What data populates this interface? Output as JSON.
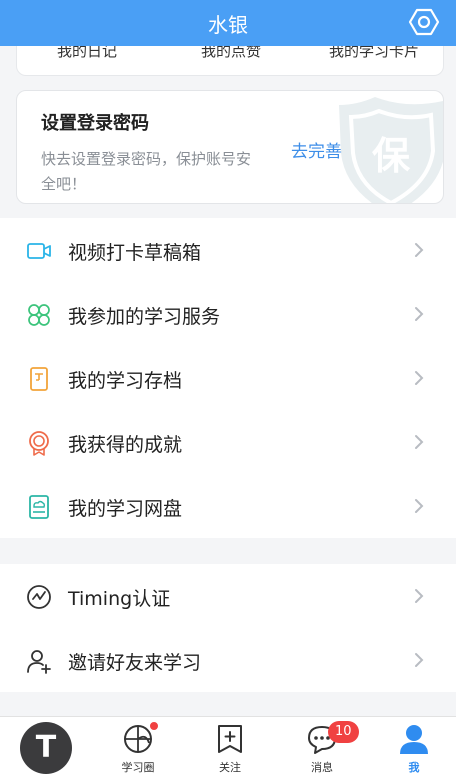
{
  "header": {
    "title": "水银",
    "settings_icon": "gear-icon"
  },
  "stats": [
    "我的日记",
    "我的点赞",
    "我的学习卡片"
  ],
  "password_card": {
    "title": "设置登录密码",
    "description": "快去设置登录密码，保护账号安全吧！",
    "action": "去完善",
    "shield_glyph": "保"
  },
  "menu_group_1": [
    {
      "label": "视频打卡草稿箱",
      "icon": "video-camera-icon"
    },
    {
      "label": "我参加的学习服务",
      "icon": "clover-icon"
    },
    {
      "label": "我的学习存档",
      "icon": "archive-card-icon"
    },
    {
      "label": "我获得的成就",
      "icon": "medal-icon"
    },
    {
      "label": "我的学习网盘",
      "icon": "cloud-disk-icon"
    }
  ],
  "menu_group_2": [
    {
      "label": "Timing认证",
      "icon": "verify-check-icon"
    },
    {
      "label": "邀请好友来学习",
      "icon": "add-user-icon"
    }
  ],
  "tabbar": {
    "avatar_letter": "T",
    "tabs": [
      {
        "label": "学习圈",
        "icon": "study-circle-icon",
        "has_dot": true
      },
      {
        "label": "关注",
        "icon": "bookmark-plus-icon"
      },
      {
        "label": "消息",
        "icon": "chat-bubble-icon",
        "badge": "10"
      },
      {
        "label": "我",
        "icon": "person-icon",
        "active": true
      }
    ]
  },
  "colors": {
    "accent": "#4a9ff5",
    "link": "#3d8ee8",
    "badge": "#f04141"
  }
}
